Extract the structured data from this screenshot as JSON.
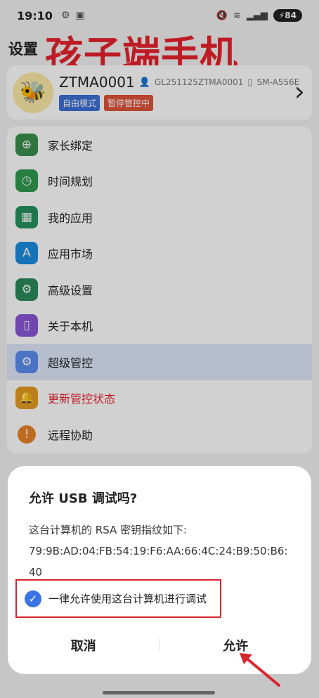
{
  "status": {
    "time": "19:10",
    "battery": "84"
  },
  "header": {
    "page_title": "设置",
    "overlay_title": "孩子端手机"
  },
  "profile": {
    "name": "ZTMA0001",
    "account": "GL251125ZTMA0001",
    "device": "SM-A556E",
    "badge1": "自由模式",
    "badge2": "暂停管控中"
  },
  "menu": {
    "items": [
      {
        "label": "家长绑定",
        "color": "#3a8f4e",
        "icon": "person-add-icon"
      },
      {
        "label": "时间规划",
        "color": "#2f9a4f",
        "icon": "clock-icon"
      },
      {
        "label": "我的应用",
        "color": "#26935f",
        "icon": "grid-icon"
      },
      {
        "label": "应用市场",
        "color": "#1d8de0",
        "icon": "app-store-icon"
      },
      {
        "label": "高级设置",
        "color": "#2a8a5c",
        "icon": "gear-icon"
      },
      {
        "label": "关于本机",
        "color": "#8a56d6",
        "icon": "phone-icon"
      },
      {
        "label": "超级管控",
        "color": "#5b8df0",
        "icon": "gear-icon"
      },
      {
        "label": "更新管控状态",
        "color": "#e79b22",
        "icon": "bell-icon"
      },
      {
        "label": "远程协助",
        "color": "#e9842a",
        "icon": "help-icon"
      }
    ]
  },
  "dialog": {
    "title": "允许 USB 调试吗?",
    "line1": "这台计算机的 RSA 密钥指纹如下:",
    "line2": "79:9B:AD:04:FB:54:19:F6:AA:66:4C:24:B9:50:B6:",
    "line3": "40",
    "checkbox_label": "一律允许使用这台计算机进行调试",
    "cancel": "取消",
    "allow": "允许"
  }
}
